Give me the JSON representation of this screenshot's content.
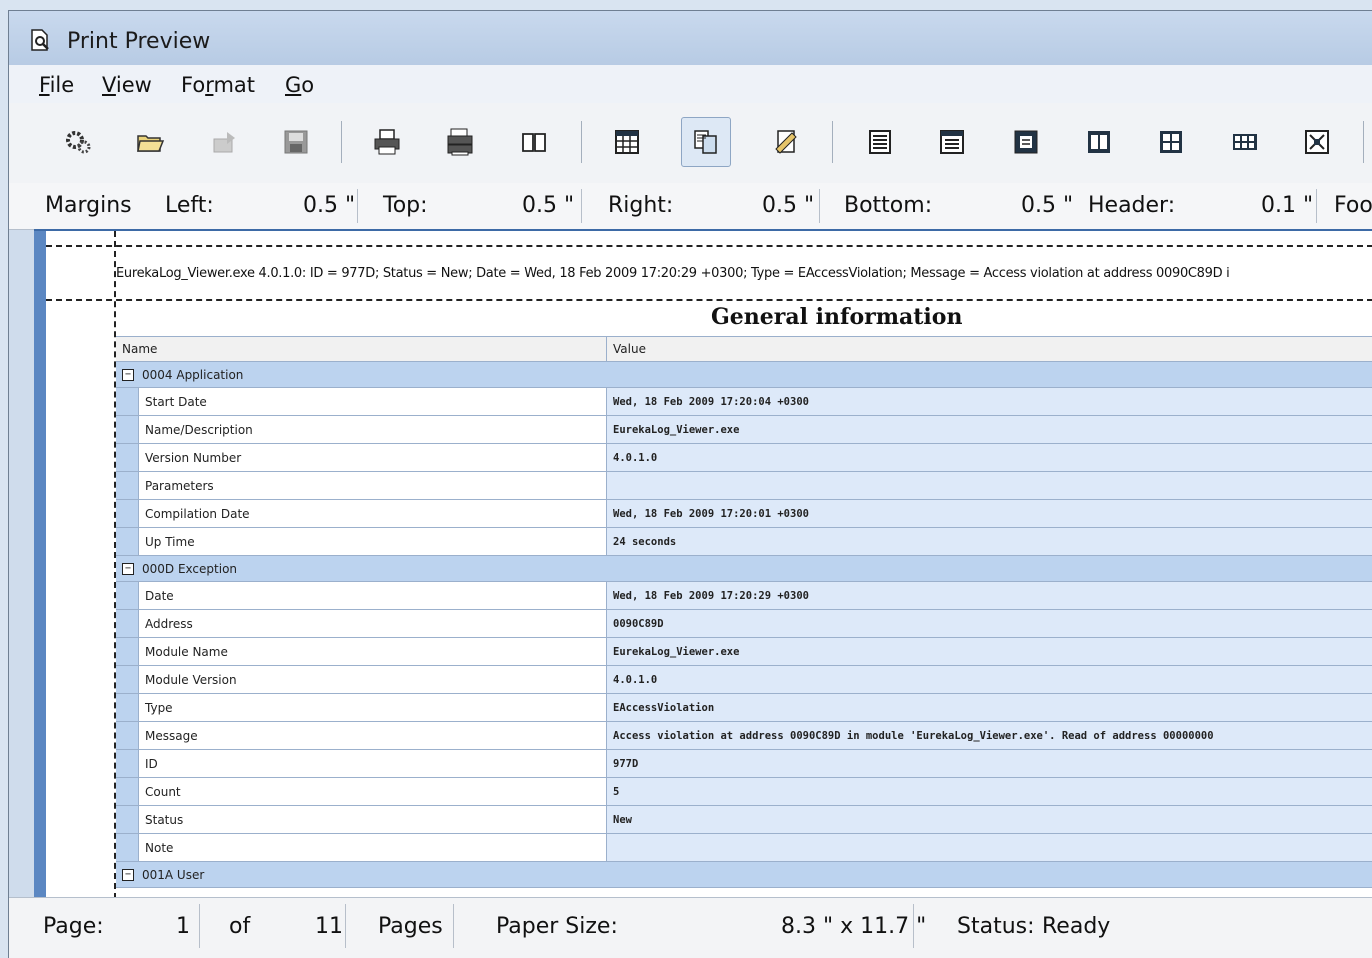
{
  "window": {
    "title": "Print Preview"
  },
  "menu": [
    {
      "u": "F",
      "rest": "ile"
    },
    {
      "u": "V",
      "rest": "iew"
    },
    {
      "pre": "Fo",
      "u": "r",
      "rest": "mat"
    },
    {
      "u": "G",
      "rest": "o"
    }
  ],
  "toolbar": {
    "icons": [
      "options-icon",
      "open-icon",
      "export-icon",
      "save-icon",
      "print-icon",
      "print-setup-icon",
      "book-icon",
      "grid-layout-icon",
      "copy-page-icon",
      "page-setup-icon",
      "single-page-icon",
      "page-width-icon",
      "whole-page-icon",
      "two-pages-icon",
      "four-pages-icon",
      "multi-pages-icon",
      "zoom-custom-icon"
    ]
  },
  "margins": {
    "label": "Margins",
    "left_label": "Left:",
    "left_value": "0.5 \"",
    "top_label": "Top:",
    "top_value": "0.5 \"",
    "right_label": "Right:",
    "right_value": "0.5 \"",
    "bottom_label": "Bottom:",
    "bottom_value": "0.5 \"",
    "header_label": "Header:",
    "header_value": "0.1 \"",
    "footer_label": "Foo"
  },
  "page": {
    "header_text": "EurekaLog_Viewer.exe 4.0.1.0: ID = 977D; Status = New; Date = Wed, 18 Feb 2009 17:20:29 +0300; Type = EAccessViolation; Message = Access violation at address 0090C89D i",
    "report_title": "General information",
    "columns": {
      "name": "Name",
      "value": "Value"
    },
    "rows": [
      {
        "type": "group",
        "label": "0004 Application"
      },
      {
        "type": "data",
        "name": "Start Date",
        "value": "Wed, 18 Feb 2009 17:20:04 +0300"
      },
      {
        "type": "data",
        "name": "Name/Description",
        "value": "EurekaLog_Viewer.exe"
      },
      {
        "type": "data",
        "name": "Version Number",
        "value": "4.0.1.0"
      },
      {
        "type": "data",
        "name": "Parameters",
        "value": ""
      },
      {
        "type": "data",
        "name": "Compilation Date",
        "value": "Wed, 18 Feb 2009 17:20:01 +0300"
      },
      {
        "type": "data",
        "name": "Up Time",
        "value": "24 seconds"
      },
      {
        "type": "group",
        "label": "000D Exception"
      },
      {
        "type": "data",
        "name": "Date",
        "value": "Wed, 18 Feb 2009 17:20:29 +0300"
      },
      {
        "type": "data",
        "name": "Address",
        "value": "0090C89D"
      },
      {
        "type": "data",
        "name": "Module Name",
        "value": "EurekaLog_Viewer.exe"
      },
      {
        "type": "data",
        "name": "Module Version",
        "value": "4.0.1.0"
      },
      {
        "type": "data",
        "name": "Type",
        "value": "EAccessViolation"
      },
      {
        "type": "data",
        "name": "Message",
        "value": "Access violation at address 0090C89D in module 'EurekaLog_Viewer.exe'. Read of address 00000000"
      },
      {
        "type": "data",
        "name": "ID",
        "value": "977D"
      },
      {
        "type": "data",
        "name": "Count",
        "value": "5"
      },
      {
        "type": "data",
        "name": "Status",
        "value": "New"
      },
      {
        "type": "data",
        "name": "Note",
        "value": ""
      },
      {
        "type": "group",
        "label": "001A User"
      }
    ]
  },
  "status": {
    "page_label": "Page:",
    "page_value": "1",
    "of_label": "of",
    "total_value": "11",
    "pages_label": "Pages",
    "paper_label": "Paper Size:",
    "paper_value": "8.3 \" x 11.7 \"",
    "status_label": "Status:",
    "status_value": "Ready"
  }
}
